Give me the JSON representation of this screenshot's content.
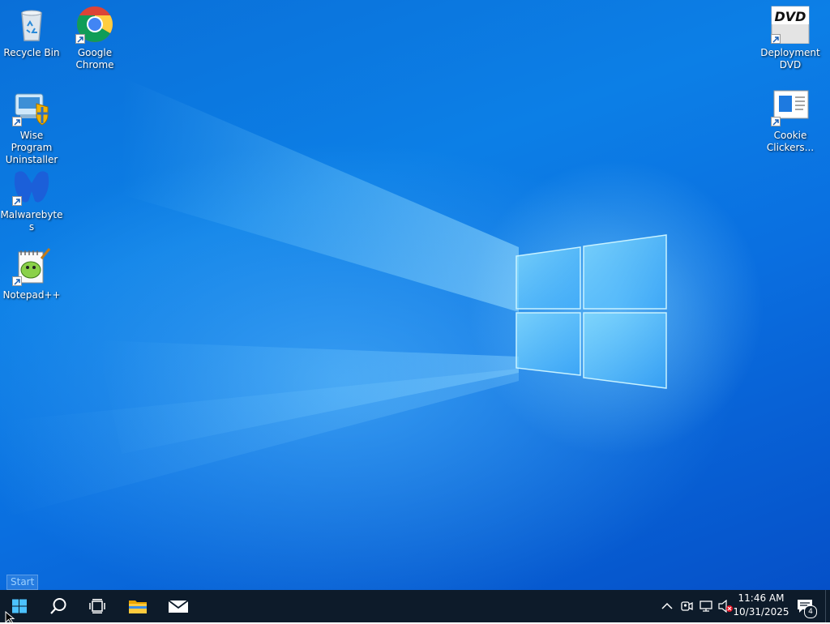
{
  "desktop": {
    "icons": [
      {
        "id": "recycle-bin",
        "label": "Recycle Bin"
      },
      {
        "id": "google-chrome",
        "label": "Google Chrome"
      },
      {
        "id": "wise-program-uninstaller",
        "label": "Wise Program Uninstaller"
      },
      {
        "id": "malwarebytes",
        "label": "Malwarebytes"
      },
      {
        "id": "notepad-plus-plus",
        "label": "Notepad++"
      },
      {
        "id": "deployment-dvd",
        "label": "DeploymentDVD",
        "image_text": "DVD"
      },
      {
        "id": "cookie-clickers",
        "label": "Cookie Clickers..."
      }
    ],
    "start_tooltip": "Start"
  },
  "taskbar": {
    "buttons": [
      {
        "id": "start",
        "icon": "windows-logo-icon"
      },
      {
        "id": "search",
        "icon": "search-icon"
      },
      {
        "id": "task-view",
        "icon": "task-view-icon"
      },
      {
        "id": "file-explorer",
        "icon": "folder-icon"
      },
      {
        "id": "mail",
        "icon": "mail-icon"
      }
    ],
    "tray": {
      "icons": [
        "chevron-up-icon",
        "meet-now-icon",
        "network-icon",
        "volume-muted-icon"
      ],
      "time": "11:46 AM",
      "date": "10/31/2025",
      "notification_count": "4"
    }
  },
  "colors": {
    "taskbar": "#0d1b2a",
    "desktop_blue": "#0a6fd8",
    "badge_red": "#e81123"
  }
}
